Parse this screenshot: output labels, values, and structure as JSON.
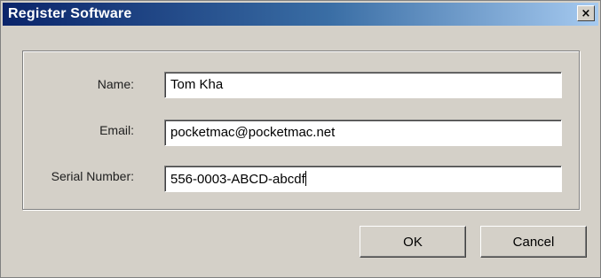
{
  "window": {
    "title": "Register Software",
    "close_label": "×"
  },
  "form": {
    "name_label": "Name:",
    "name_value": "Tom Kha",
    "email_label": "Email:",
    "email_value": "pocketmac@pocketmac.net",
    "serial_label": "Serial Number:",
    "serial_value": "556-0003-ABCD-abcdf"
  },
  "buttons": {
    "ok_label": "OK",
    "cancel_label": "Cancel"
  }
}
